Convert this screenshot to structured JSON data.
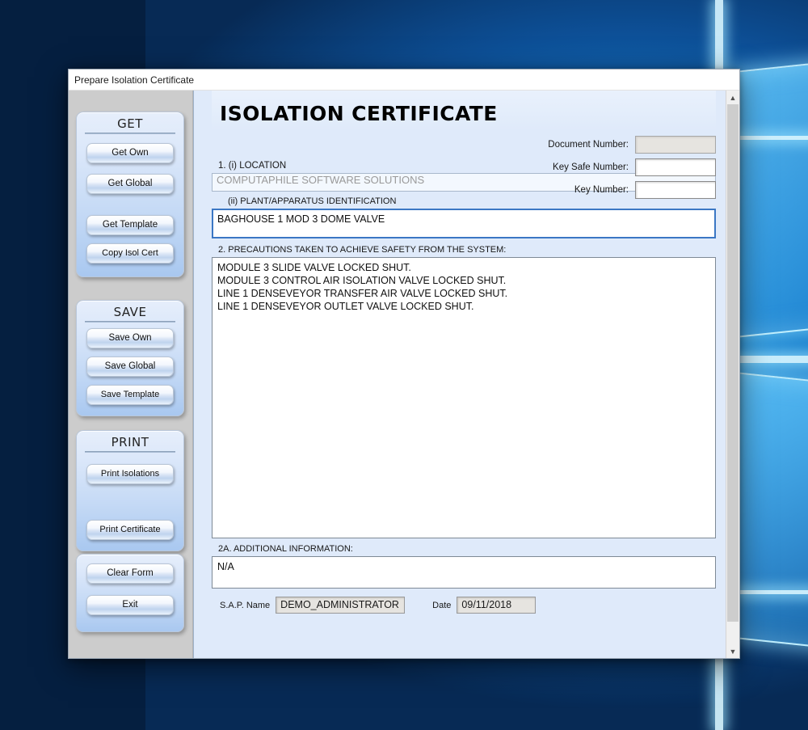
{
  "window": {
    "title": "Prepare Isolation Certificate"
  },
  "sidebar": {
    "groups": [
      {
        "title": "GET",
        "buttons": [
          {
            "label": "Get Own",
            "name": "get-own-button"
          },
          {
            "label": "Get Global",
            "name": "get-global-button"
          },
          {
            "label": "Get Template",
            "name": "get-template-button"
          },
          {
            "label": "Copy Isol Cert",
            "name": "copy-isol-cert-button"
          }
        ]
      },
      {
        "title": "SAVE",
        "buttons": [
          {
            "label": "Save Own",
            "name": "save-own-button"
          },
          {
            "label": "Save Global",
            "name": "save-global-button"
          },
          {
            "label": "Save Template",
            "name": "save-template-button"
          }
        ]
      },
      {
        "title": "PRINT",
        "buttons": [
          {
            "label": "Print Isolations",
            "name": "print-isolations-button"
          },
          {
            "label": "Print Certificate",
            "name": "print-certificate-button"
          }
        ]
      }
    ],
    "extra_buttons": [
      {
        "label": "Clear Form",
        "name": "clear-form-button"
      },
      {
        "label": "Exit",
        "name": "exit-button"
      }
    ]
  },
  "form": {
    "title": "ISOLATION CERTIFICATE",
    "header_fields": [
      {
        "label": "Document Number:",
        "value": "",
        "disabled": true
      },
      {
        "label": "Key Safe Number:",
        "value": "",
        "disabled": false
      },
      {
        "label": "Key Number:",
        "value": "",
        "disabled": false
      }
    ],
    "location": {
      "label": "1.  (i) LOCATION",
      "value": "COMPUTAPHILE SOFTWARE SOLUTIONS"
    },
    "plant": {
      "label": "(ii)  PLANT/APPARATUS  IDENTIFICATION",
      "value": "BAGHOUSE 1 MOD 3 DOME VALVE"
    },
    "precautions": {
      "label": "2.   PRECAUTIONS  TAKEN  TO  ACHIEVE  SAFETY  FROM  THE  SYSTEM:",
      "value": "MODULE 3 SLIDE VALVE LOCKED SHUT.\nMODULE 3 CONTROL AIR ISOLATION VALVE LOCKED SHUT.\nLINE 1 DENSEVEYOR TRANSFER AIR VALVE LOCKED SHUT.\nLINE 1 DENSEVEYOR OUTLET VALVE LOCKED SHUT."
    },
    "additional": {
      "label": "2A.    ADDITIONAL  INFORMATION:",
      "value": "N/A"
    },
    "footer": {
      "sap_label": "S.A.P. Name",
      "sap_value": "DEMO_ADMINISTRATOR",
      "date_label": "Date",
      "date_value": "09/11/2018"
    }
  },
  "scrollbar": {
    "up_glyph": "▲",
    "down_glyph": "▼"
  },
  "colors": {
    "form_background": "#dfeafa",
    "sidebar_background": "#cccccc",
    "button_blue": "#bfd3ee",
    "focus_border": "#3b77c4",
    "disabled_field": "#e6e4e0"
  }
}
